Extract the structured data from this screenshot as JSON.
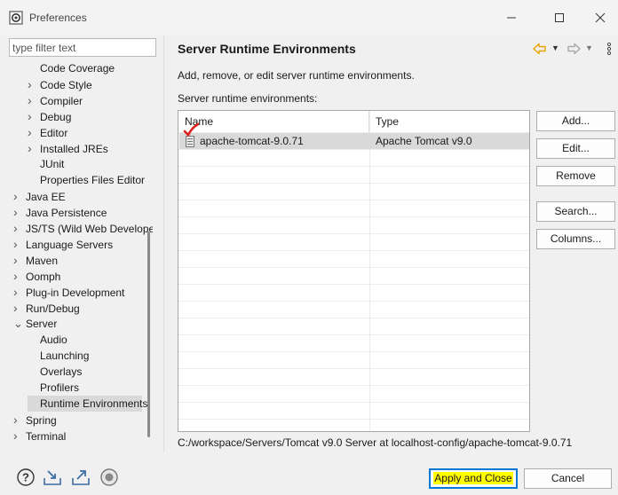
{
  "window": {
    "title": "Preferences"
  },
  "filter": {
    "placeholder": "type filter text"
  },
  "tree": {
    "items": [
      {
        "label": "Code Coverage",
        "indent": 2,
        "chevron": ""
      },
      {
        "label": "Code Style",
        "indent": 2,
        "chevron": "right"
      },
      {
        "label": "Compiler",
        "indent": 2,
        "chevron": "right"
      },
      {
        "label": "Debug",
        "indent": 2,
        "chevron": "right"
      },
      {
        "label": "Editor",
        "indent": 2,
        "chevron": "right"
      },
      {
        "label": "Installed JREs",
        "indent": 2,
        "chevron": "right"
      },
      {
        "label": "JUnit",
        "indent": 2,
        "chevron": ""
      },
      {
        "label": "Properties Files Editor",
        "indent": 2,
        "chevron": ""
      },
      {
        "label": "Java EE",
        "indent": 1,
        "chevron": "right"
      },
      {
        "label": "Java Persistence",
        "indent": 1,
        "chevron": "right"
      },
      {
        "label": "JS/TS (Wild Web Developer)",
        "indent": 1,
        "chevron": "right"
      },
      {
        "label": "Language Servers",
        "indent": 1,
        "chevron": "right"
      },
      {
        "label": "Maven",
        "indent": 1,
        "chevron": "right"
      },
      {
        "label": "Oomph",
        "indent": 1,
        "chevron": "right"
      },
      {
        "label": "Plug-in Development",
        "indent": 1,
        "chevron": "right"
      },
      {
        "label": "Run/Debug",
        "indent": 1,
        "chevron": "right"
      },
      {
        "label": "Server",
        "indent": 1,
        "chevron": "down"
      },
      {
        "label": "Audio",
        "indent": 2,
        "chevron": ""
      },
      {
        "label": "Launching",
        "indent": 2,
        "chevron": ""
      },
      {
        "label": "Overlays",
        "indent": 2,
        "chevron": ""
      },
      {
        "label": "Profilers",
        "indent": 2,
        "chevron": ""
      },
      {
        "label": "Runtime Environments",
        "indent": 2,
        "chevron": "",
        "selected": true
      },
      {
        "label": "Spring",
        "indent": 1,
        "chevron": "right"
      },
      {
        "label": "Terminal",
        "indent": 1,
        "chevron": "right"
      }
    ]
  },
  "page": {
    "title": "Server Runtime Environments",
    "description": "Add, remove, or edit server runtime environments.",
    "list_label": "Server runtime environments:"
  },
  "table": {
    "columns": [
      "Name",
      "Type"
    ],
    "rows": [
      {
        "name": "apache-tomcat-9.0.71",
        "type": "Apache Tomcat v9.0",
        "checked": true
      }
    ]
  },
  "side_buttons": {
    "add": "Add...",
    "edit": "Edit...",
    "remove": "Remove",
    "search": "Search...",
    "columns": "Columns..."
  },
  "location": "C:/workspace/Servers/Tomcat v9.0 Server at localhost-config/apache-tomcat-9.0.71",
  "footer": {
    "apply_close": "Apply and Close",
    "cancel": "Cancel"
  },
  "colors": {
    "accent": "#0078d4",
    "highlight": "#ffff00",
    "check_mark": "#e02020",
    "back_arrow": "#e8a400"
  }
}
